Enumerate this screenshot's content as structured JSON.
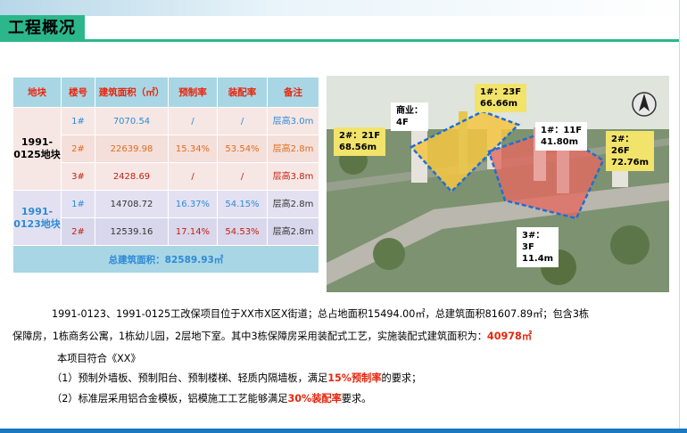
{
  "header": {
    "title": "工程概况"
  },
  "table": {
    "headers": [
      "地块",
      "楼号",
      "建筑面积（㎡）",
      "预制率",
      "装配率",
      "备注"
    ],
    "groups": [
      {
        "block": "1991-0125地块",
        "rows": [
          {
            "building": "1#",
            "area": "7070.54",
            "prefab": "/",
            "assembly": "/",
            "note": "层高3.0m"
          },
          {
            "building": "2#",
            "area": "22639.98",
            "prefab": "15.34%",
            "assembly": "53.54%",
            "note": "层高2.8m"
          },
          {
            "building": "3#",
            "area": "2428.69",
            "prefab": "/",
            "assembly": "/",
            "note": "层高3.8m"
          }
        ]
      },
      {
        "block": "1991-0123地块",
        "rows": [
          {
            "building": "1#",
            "area": "14708.72",
            "prefab": "16.37%",
            "assembly": "54.15%",
            "note": "层高2.8m"
          },
          {
            "building": "2#",
            "area": "12539.16",
            "prefab": "17.14%",
            "assembly": "54.53%",
            "note": "层高2.8m"
          }
        ]
      }
    ],
    "total": "总建筑面积：82589.93㎡"
  },
  "image": {
    "labels": [
      {
        "text": "商业：\n4F"
      },
      {
        "text": "1#：23F\n66.66m"
      },
      {
        "text": "2#：21F\n68.56m"
      },
      {
        "text": "1#：11F\n41.80m"
      },
      {
        "text": "2#：\n26F\n72.76m"
      },
      {
        "text": "3#：\n3F\n11.4m"
      }
    ]
  },
  "body": {
    "p1_line1": "1991-0123、1991-0125工改保项目位于XX市X区X街道；总占地面积15494.00㎡，总建筑面积81607.89㎡；包含3栋",
    "p1_line2_a": "保障房，1栋商务公寓，1栋幼儿园，2层地下室。其中3栋保障房采用装配式工艺，实施装配式建筑面积为：",
    "p1_line2_hl": "40978㎡",
    "p2": "本项目符合《XX》",
    "p3_a": "（1）预制外墙板、预制阳台、预制楼梯、轻质内隔墙板，满足",
    "p3_hl": "15%预制率",
    "p3_b": "的要求；",
    "p4_a": "（2）标准层采用铝合金模板，铝模施工工艺能够满足",
    "p4_hl": "30%装配率",
    "p4_b": "要求。"
  }
}
